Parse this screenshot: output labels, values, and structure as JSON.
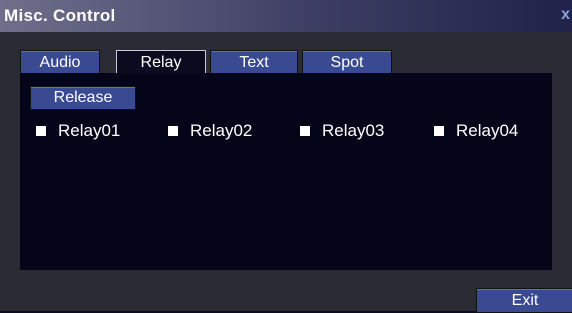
{
  "window": {
    "title": "Misc. Control",
    "close_label": "x"
  },
  "tabs": [
    {
      "label": "Audio",
      "active": false
    },
    {
      "label": "Relay",
      "active": true
    },
    {
      "label": "Text",
      "active": false
    },
    {
      "label": "Spot",
      "active": false
    }
  ],
  "relay_panel": {
    "release_label": "Release",
    "relays": [
      {
        "label": "Relay01",
        "checked": false
      },
      {
        "label": "Relay02",
        "checked": false
      },
      {
        "label": "Relay03",
        "checked": false
      },
      {
        "label": "Relay04",
        "checked": false
      }
    ]
  },
  "footer": {
    "exit_label": "Exit"
  },
  "colors": {
    "button": "#3a4a92",
    "content_bg": "#05051a",
    "frame_bg": "#2a2b34",
    "text": "#ffffff"
  }
}
